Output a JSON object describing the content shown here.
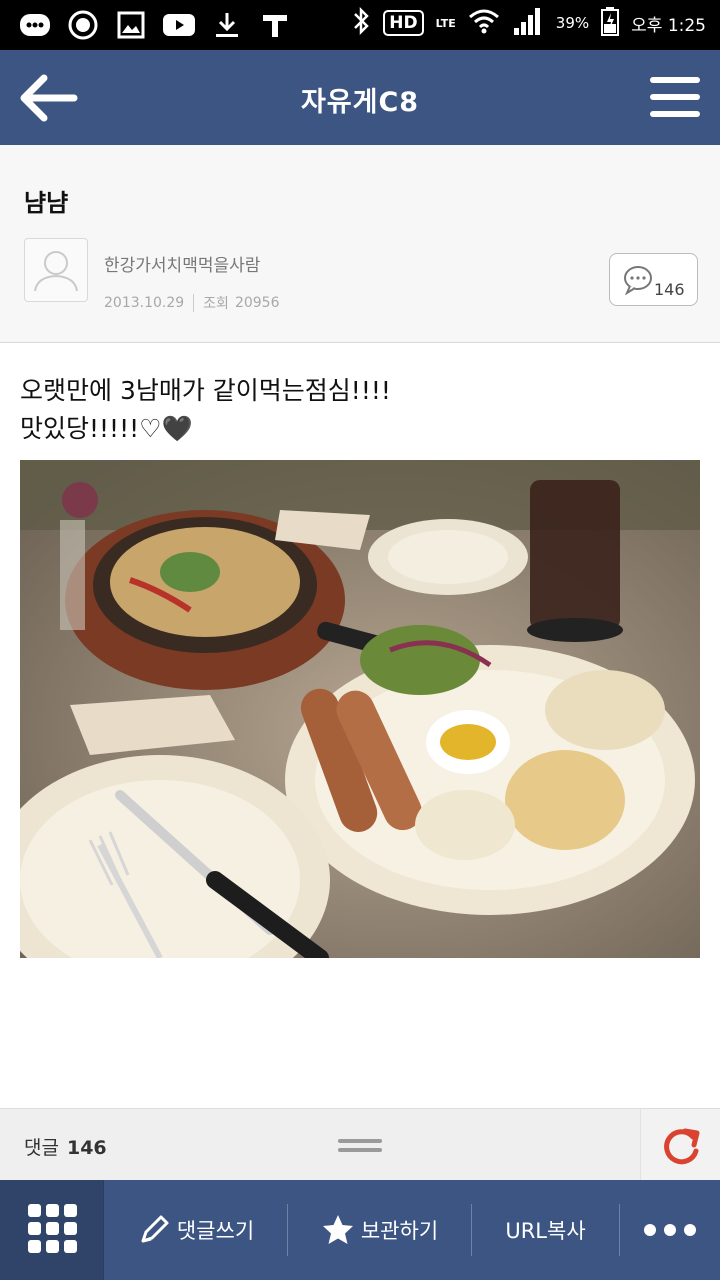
{
  "status_bar": {
    "battery": "39%",
    "time": "오후 1:25",
    "network": "LTE",
    "hd": "HD"
  },
  "app_bar": {
    "title": "자유게C8"
  },
  "post": {
    "title": "냠냠",
    "author": "한강가서치맥먹을사람",
    "date": "2013.10.29",
    "views_label": "조회",
    "views": "20956",
    "comment_count": "146",
    "body_line1": "오랫만에 3남매가 같이먹는점심!!!!",
    "body_line2": "맛있당!!!!!♡🖤"
  },
  "comment_bar": {
    "label": "댓글",
    "count": "146"
  },
  "bottom_nav": {
    "write_comment": "댓글쓰기",
    "save": "보관하기",
    "copy_url": "URL복사"
  },
  "colors": {
    "header": "#3d5582",
    "accent_refresh": "#d9432f"
  }
}
